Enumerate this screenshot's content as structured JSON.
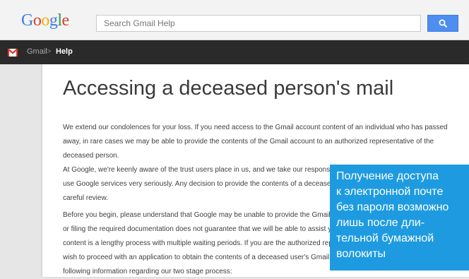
{
  "header": {
    "logo_text": "Google",
    "logo_colors": [
      "#3f7ee8",
      "#d8402f",
      "#f0b000",
      "#3f7ee8",
      "#2e9b4e",
      "#d8402f"
    ],
    "search_placeholder": "Search Gmail Help",
    "search_button_icon": "search-icon",
    "accent_color": "#4d8ef0"
  },
  "nav": {
    "product_icon": "gmail-icon",
    "crumbs": [
      "Gmail",
      "Help"
    ],
    "separator": ">"
  },
  "article": {
    "title": "Accessing a deceased person's mail",
    "paragraphs": [
      "We extend our condolences for your loss. If you need access to the Gmail account content of an individual who has passed away, in rare cases we may be able to provide the contents of the Gmail account to an authorized representative of the deceased person.",
      "At Google, we're keenly aware of the trust users place in us, and we take our responsibility to protect the privacy of people who use Google services very seriously. Any decision to provide the contents of a deceased user's email will be made only after a careful review.",
      "Before you begin, please understand that Google may be unable to provide the Gmail account content, and submitting a request or filing the required documentation does not guarantee that we will be able to assist you. Obtaining a deceased user's email content is a lengthy process with multiple waiting periods. If you are the authorized representative of a deceased person and wish to proceed with an application to obtain the contents of a deceased user's Gmail account, please carefully review the following information regarding our two stage process:"
    ]
  },
  "overlay": {
    "lines": [
      "Получение доступа",
      "к электронной почте",
      "без пароля возможно",
      "лишь после дли-",
      "тельной бумажной",
      "волокиты"
    ],
    "background_color": "#1e9be0"
  }
}
